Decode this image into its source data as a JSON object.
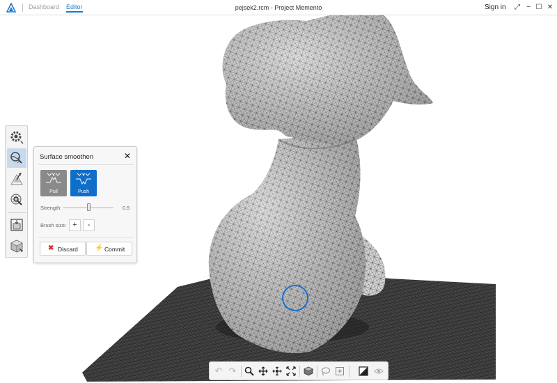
{
  "titlebar": {
    "tabs": [
      "Dashboard",
      "Editor"
    ],
    "active_tab": "Editor",
    "window_title": "pejsek2.rcm - Project Memento",
    "signin_label": "Sign in",
    "controls": {
      "expand": "⤢",
      "minimize": "−",
      "maximize": "☐",
      "close": "✕"
    }
  },
  "left_toolbar": {
    "tools": [
      {
        "icon": "gear-tool-icon",
        "active": false
      },
      {
        "icon": "surface-smoothen-tool-icon",
        "active": true
      },
      {
        "icon": "paint-brush-tool-icon",
        "active": false
      },
      {
        "icon": "sphere-inspect-tool-icon",
        "active": false
      },
      {
        "icon": "export-tool-icon",
        "active": false
      },
      {
        "icon": "view-cube-tool-icon",
        "active": false
      }
    ]
  },
  "panel": {
    "title": "Surface smoothen",
    "close_label": "✕",
    "modes": [
      {
        "label": "Pull",
        "selected": false
      },
      {
        "label": "Push",
        "selected": true
      }
    ],
    "strength_label": "Strength:",
    "strength_value": "0.5",
    "strength_fraction": 0.5,
    "brush_size_label": "Brush size:",
    "brush_plus": "+",
    "brush_minus": "-",
    "discard_icon": "✖",
    "discard_label": "Discard",
    "commit_icon": "⚡",
    "commit_label": "Commit"
  },
  "bottom_toolbar": {
    "undo_icon": "↶",
    "redo_icon": "↷",
    "tools": [
      "undo-icon",
      "redo-icon",
      "zoom-icon",
      "pan-icon",
      "orbit-icon",
      "fit-view-icon",
      "solid-cube-icon",
      "lasso-select-icon",
      "box-select-icon",
      "shading-mode-icon",
      "visibility-icon"
    ]
  },
  "colors": {
    "accent": "#1f7ac8",
    "push_button": "#0e6ec8",
    "pull_button": "#8a8a8a",
    "brush_cursor": "#1a6fd0",
    "mesh_fill": "#d2d2d2",
    "mesh_lines": "#2a2a2a",
    "ground": "#3c3c3c"
  }
}
